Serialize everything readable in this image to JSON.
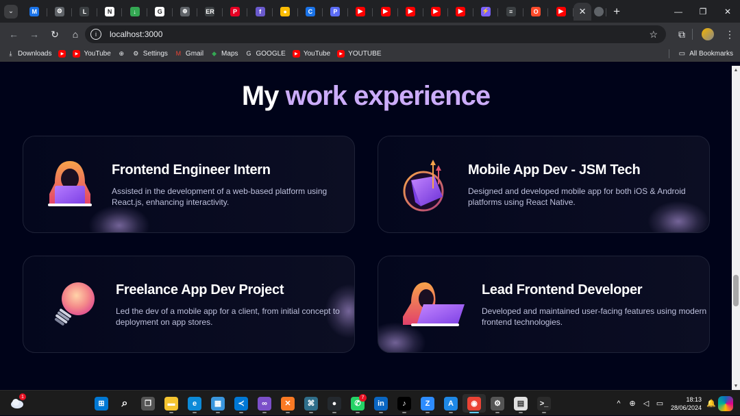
{
  "browser": {
    "tab_favicons": [
      {
        "icon": "m-icon",
        "color": "#1a73e8",
        "text": "M"
      },
      {
        "icon": "settings-icon",
        "color": "#5f6368",
        "text": "⚙"
      },
      {
        "icon": "l-icon",
        "color": "#3c4043",
        "text": "L"
      },
      {
        "icon": "notion-icon",
        "color": "#ffffff",
        "text": "N"
      },
      {
        "icon": "download-icon",
        "color": "#34a853",
        "text": "↓"
      },
      {
        "icon": "google-icon",
        "color": "#ffffff",
        "text": "G"
      },
      {
        "icon": "globe-icon",
        "color": "#5f6368",
        "text": "⊕"
      },
      {
        "icon": "er-icon",
        "color": "#3c4043",
        "text": "ER"
      },
      {
        "icon": "pinterest-icon",
        "color": "#e60023",
        "text": "P"
      },
      {
        "icon": "flow-icon",
        "color": "#6a5acd",
        "text": "f"
      },
      {
        "icon": "bulb-icon",
        "color": "#fbbc04",
        "text": "●"
      },
      {
        "icon": "c-icon",
        "color": "#1a73e8",
        "text": "C"
      },
      {
        "icon": "p-icon",
        "color": "#5b6cf5",
        "text": "P"
      },
      {
        "icon": "youtube-icon",
        "color": "#ff0000",
        "text": "▶"
      },
      {
        "icon": "youtube-icon",
        "color": "#ff0000",
        "text": "▶"
      },
      {
        "icon": "youtube-icon",
        "color": "#ff0000",
        "text": "▶"
      },
      {
        "icon": "youtube-icon",
        "color": "#ff0000",
        "text": "▶"
      },
      {
        "icon": "youtube-icon",
        "color": "#ff0000",
        "text": "▶"
      },
      {
        "icon": "bolt-icon",
        "color": "#7b61ff",
        "text": "⚡"
      },
      {
        "icon": "terminal-icon",
        "color": "#3c4043",
        "text": "≡"
      },
      {
        "icon": "opera-icon",
        "color": "#ff4b2b",
        "text": "O"
      },
      {
        "icon": "multi-icon",
        "color": "#ff0000",
        "text": "▶"
      }
    ],
    "active_tab_close": "✕",
    "new_tab": "+",
    "window_controls": {
      "minimize": "—",
      "maximize": "❐",
      "close": "✕"
    },
    "url": "localhost:3000",
    "bookmarks": [
      {
        "label": "Downloads",
        "icon": "download-icon"
      },
      {
        "label": "",
        "icon": "youtube-icon"
      },
      {
        "label": "YouTube",
        "icon": "youtube-icon"
      },
      {
        "label": "",
        "icon": "globe-icon"
      },
      {
        "label": "Settings",
        "icon": "gear-icon"
      },
      {
        "label": "Gmail",
        "icon": "gmail-icon"
      },
      {
        "label": "Maps",
        "icon": "maps-icon"
      },
      {
        "label": "GOOGLE",
        "icon": "google-icon"
      },
      {
        "label": "YouTube",
        "icon": "youtube-icon"
      },
      {
        "label": "YOUTUBE",
        "icon": "youtube-icon"
      }
    ],
    "all_bookmarks": "All Bookmarks"
  },
  "page": {
    "heading_prefix": "My",
    "heading_accent": "work experience",
    "accent_color": "#cbacf9",
    "cards": [
      {
        "title": "Frontend Engineer Intern",
        "desc": "Assisted in the development of a web-based platform using React.js, enhancing interactivity.",
        "icon": "hooded-coder-icon"
      },
      {
        "title": "Mobile App Dev - JSM Tech",
        "desc": "Designed and developed mobile app for both iOS & Android platforms using React Native.",
        "icon": "laptop-growth-icon"
      },
      {
        "title": "Freelance App Dev Project",
        "desc": "Led the dev of a mobile app for a client, from initial concept to deployment on app stores.",
        "icon": "lightbulb-icon"
      },
      {
        "title": "Lead Frontend Developer",
        "desc": "Developed and maintained user-facing features using modern frontend technologies.",
        "icon": "hooded-coder-laptop-icon"
      }
    ]
  },
  "taskbar": {
    "weather_badge": "1",
    "apps": [
      {
        "name": "windows-start-icon",
        "color": "#0078d4",
        "text": "⊞"
      },
      {
        "name": "search-icon",
        "color": "transparent",
        "text": "⌕"
      },
      {
        "name": "task-view-icon",
        "color": "#555555",
        "text": "❐"
      },
      {
        "name": "file-explorer-icon",
        "color": "#f4c430",
        "text": "▬"
      },
      {
        "name": "edge-icon",
        "color": "#0c8ad8",
        "text": "e"
      },
      {
        "name": "store-icon",
        "color": "#3a96dd",
        "text": "▦"
      },
      {
        "name": "vscode-icon",
        "color": "#0078d4",
        "text": "≺"
      },
      {
        "name": "visual-studio-icon",
        "color": "#7b4fc9",
        "text": "∞"
      },
      {
        "name": "xampp-icon",
        "color": "#fb7a24",
        "text": "✕"
      },
      {
        "name": "mysql-icon",
        "color": "#2f6e8a",
        "text": "⌘"
      },
      {
        "name": "github-icon",
        "color": "#24292e",
        "text": "●"
      },
      {
        "name": "whatsapp-icon",
        "color": "#25d366",
        "text": "✆",
        "badge": "7"
      },
      {
        "name": "linkedin-icon",
        "color": "#0a66c2",
        "text": "in"
      },
      {
        "name": "tiktok-icon",
        "color": "#000000",
        "text": "♪"
      },
      {
        "name": "zoom-icon",
        "color": "#2d8cff",
        "text": "Z"
      },
      {
        "name": "app-store-icon",
        "color": "#1e88e5",
        "text": "A"
      },
      {
        "name": "chrome-icon",
        "color": "#ea4335",
        "text": "◉",
        "active": true
      },
      {
        "name": "settings-icon",
        "color": "#555555",
        "text": "⚙"
      },
      {
        "name": "notepad-icon",
        "color": "#e0e0e0",
        "text": "▤"
      },
      {
        "name": "terminal-icon",
        "color": "#2b2b2b",
        "text": ">_"
      }
    ],
    "time": "18:13",
    "date": "28/06/2024"
  }
}
